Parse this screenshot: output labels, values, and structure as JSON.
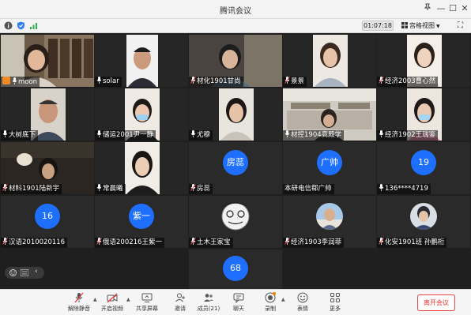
{
  "window": {
    "title": "腾讯会议"
  },
  "infobar": {
    "timer": "01:07:18",
    "grid_view_label": "宫格视图"
  },
  "participants": [
    {
      "name": "moon",
      "host": true
    },
    {
      "name": "solar"
    },
    {
      "name": "材化1901甘尚"
    },
    {
      "name": "景景"
    },
    {
      "name": "经济2003曹心然"
    },
    {
      "name": "大树底下"
    },
    {
      "name": "储运2001尹一静"
    },
    {
      "name": "尤穆"
    },
    {
      "name": "材控1904高殿学"
    },
    {
      "name": "经济1902王瑞鉴"
    },
    {
      "name": "材料1901陆新宇"
    },
    {
      "name": "常晨曦"
    },
    {
      "name": "房蕊",
      "avatar_text": "房蕊"
    },
    {
      "name": "本研电信郗广帅",
      "avatar_text": "广帅"
    },
    {
      "name": "136****4719",
      "avatar_text": "19"
    },
    {
      "name": "汉语2010020116",
      "avatar_text": "16"
    },
    {
      "name": "俄语200216王紫一",
      "avatar_text": "紫一"
    },
    {
      "name": "土木王家宝"
    },
    {
      "name": "经济1903李润菲"
    },
    {
      "name": "化安1901班 孙鹏桁"
    },
    {
      "name": "",
      "avatar_text": "68"
    }
  ],
  "toolbar": {
    "mute": "解除静音",
    "video": "开启视频",
    "share": "共享屏幕",
    "invite": "邀请",
    "members": "成员(21)",
    "chat": "聊天",
    "record": "录制",
    "reactions": "表情",
    "more": "更多",
    "leave": "离开会议"
  }
}
